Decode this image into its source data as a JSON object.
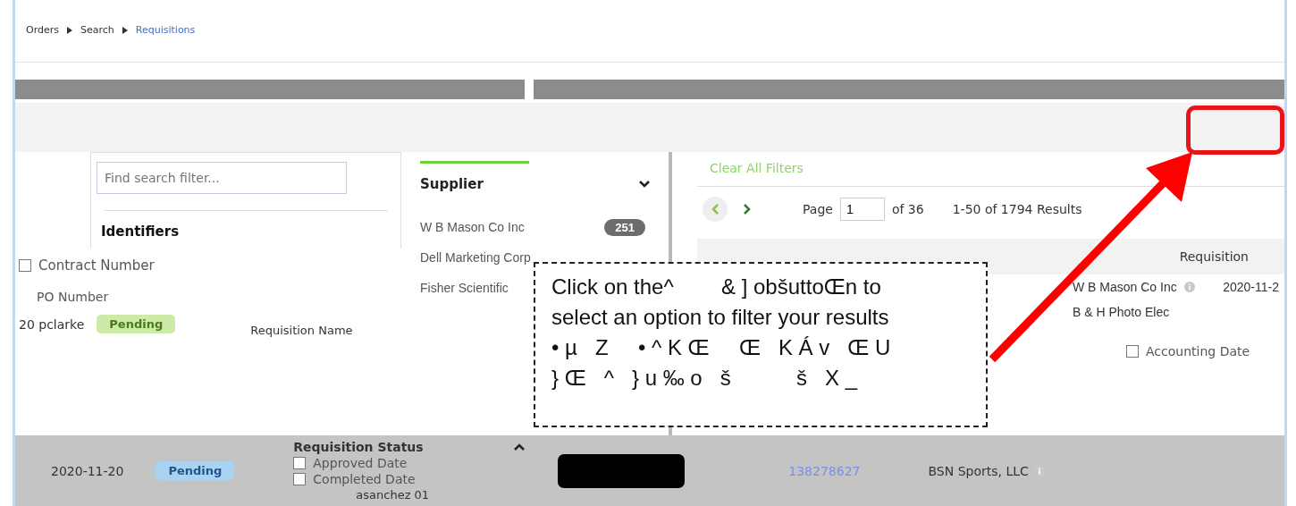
{
  "breadcrumb": [
    {
      "label": "Orders",
      "selected": false
    },
    {
      "label": "Search",
      "selected": false
    },
    {
      "label": "Requisitions",
      "selected": true
    }
  ],
  "filter_panel": {
    "search": {
      "placeholder": "Find search filter..."
    },
    "section": "Identifiers",
    "options": [
      {
        "kind": "checkbox",
        "label": "Contract Number",
        "checked": false
      },
      {
        "kind": "plain",
        "label": "PO Number"
      }
    ]
  },
  "left_rows": [
    {
      "text": "20 pclarke",
      "status": {
        "label": "Pending",
        "color": "#cdeaa8"
      },
      "field": "Requisition Name"
    }
  ],
  "supplier_facet": {
    "title": "Supplier",
    "expanded": true,
    "items": [
      {
        "name": "W B Mason Co Inc",
        "count": "251"
      },
      {
        "name": "Dell Marketing Corp"
      },
      {
        "name": "Fisher Scientific"
      }
    ]
  },
  "results": {
    "clear_filters": "Clear All Filters",
    "pager": {
      "label": "Page",
      "page": "1",
      "of": "of 36",
      "summary": "1-50 of 1794 Results"
    },
    "column": "Requisition",
    "rows": [
      {
        "supplier": "W B Mason Co Inc",
        "date": "2020-11-2"
      },
      {
        "supplier": "B & H Photo Elec"
      }
    ],
    "date_options": [
      {
        "label": "Accounting Date",
        "checked": false
      }
    ]
  },
  "bottom_row": {
    "date": "2020-11-20",
    "status": {
      "label": "Pending",
      "color": "#a9d3f0"
    },
    "facet": {
      "title": "Requisition Status",
      "expanded": false,
      "options": [
        {
          "label": "Approved Date",
          "checked": false
        },
        {
          "label": "Completed Date",
          "checked": false
        }
      ],
      "user": "asanchez 01"
    },
    "number": "138278627",
    "supplier": "BSN Sports, LLC"
  },
  "callout": {
    "lines": [
      "Click on the^        & ] obšuttoŒn to",
      "select an option to filter your results",
      "• µ   Z     • ^ K Œ     Œ   K Á v   Œ U",
      "} Œ   ^   } u ‰ o   š           š   X _"
    ]
  }
}
